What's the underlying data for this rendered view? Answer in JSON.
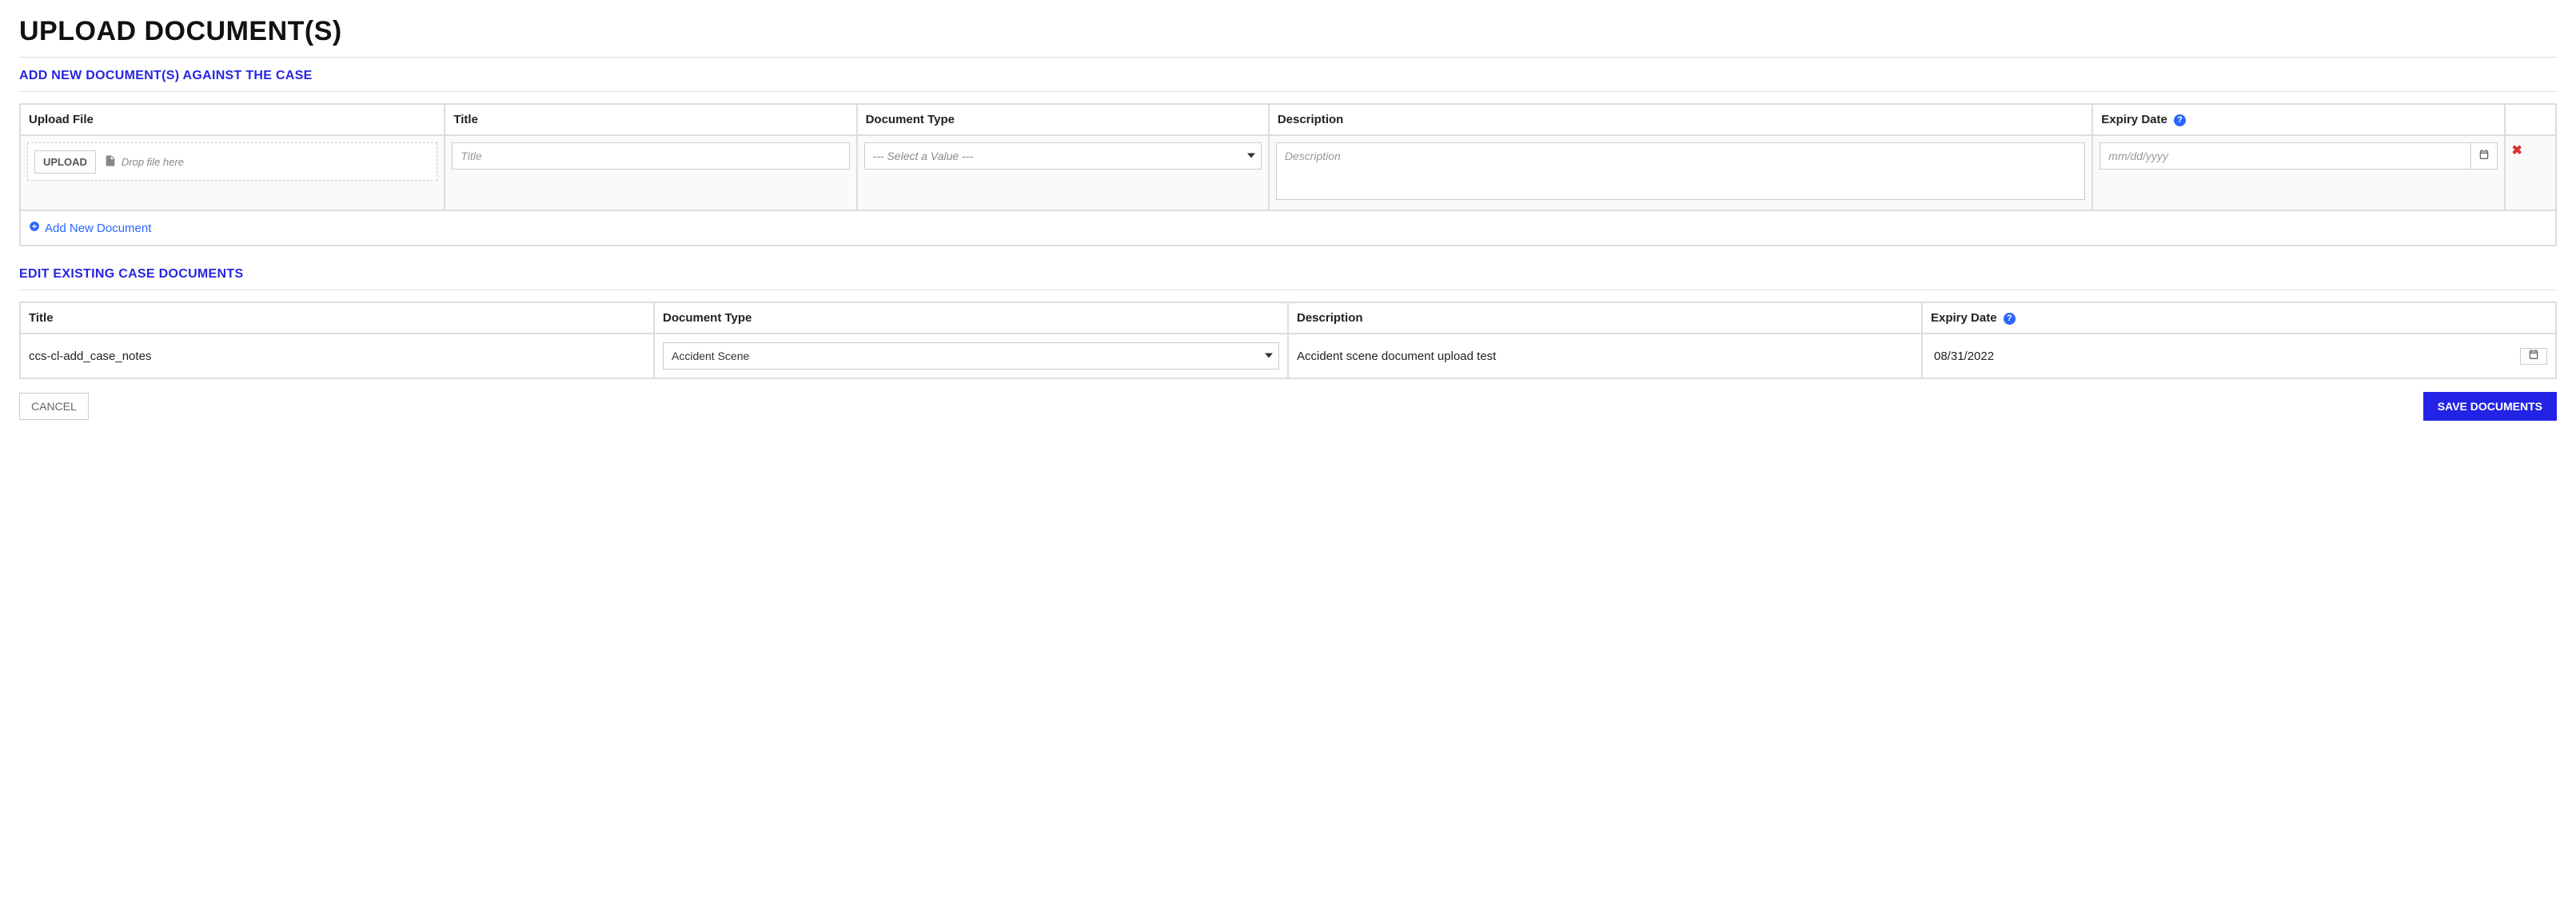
{
  "page": {
    "title": "UPLOAD DOCUMENT(S)"
  },
  "sections": {
    "add": {
      "title": "ADD NEW DOCUMENT(S) AGAINST THE CASE",
      "headers": {
        "upload_file": "Upload File",
        "title": "Title",
        "document_type": "Document Type",
        "description": "Description",
        "expiry_date": "Expiry Date"
      },
      "row": {
        "upload_button": "UPLOAD",
        "drop_hint": "Drop file here",
        "title_value": "",
        "title_placeholder": "Title",
        "type_value": "",
        "type_placeholder": "--- Select a Value ---",
        "description_value": "",
        "description_placeholder": "Description",
        "date_value": "",
        "date_placeholder": "mm/dd/yyyy"
      },
      "add_link": "Add New Document"
    },
    "edit": {
      "title": "EDIT EXISTING CASE DOCUMENTS",
      "headers": {
        "title": "Title",
        "document_type": "Document Type",
        "description": "Description",
        "expiry_date": "Expiry Date"
      },
      "rows": [
        {
          "title": "ccs-cl-add_case_notes",
          "document_type": "Accident Scene",
          "description": "Accident scene document upload test",
          "expiry_date": "08/31/2022"
        }
      ]
    }
  },
  "footer": {
    "cancel": "CANCEL",
    "save": "SAVE DOCUMENTS"
  },
  "help_tooltip_glyph": "?"
}
